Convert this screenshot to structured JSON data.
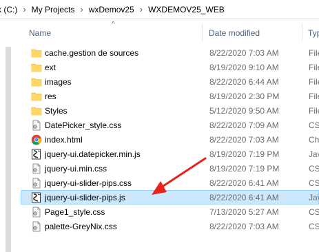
{
  "breadcrumb": [
    "k (C:)",
    "My Projects",
    "wxDemov25",
    "WXDEMOV25_WEB"
  ],
  "columns": {
    "name": "Name",
    "date": "Date modified",
    "type": "Typ"
  },
  "files": [
    {
      "name": "cache.gestion de sources",
      "date": "8/22/2020 7:03 AM",
      "type": "File",
      "icon": "folder-icon"
    },
    {
      "name": "ext",
      "date": "8/19/2020 9:10 AM",
      "type": "File",
      "icon": "folder-icon"
    },
    {
      "name": "images",
      "date": "8/22/2020 6:44 AM",
      "type": "File",
      "icon": "folder-icon"
    },
    {
      "name": "res",
      "date": "8/19/2020 2:30 PM",
      "type": "File",
      "icon": "folder-icon"
    },
    {
      "name": "Styles",
      "date": "5/12/2020 9:50 AM",
      "type": "File",
      "icon": "folder-icon"
    },
    {
      "name": "DatePicker_style.css",
      "date": "8/22/2020 7:09 AM",
      "type": "CSS",
      "icon": "css-file-icon"
    },
    {
      "name": "index.html",
      "date": "8/22/2020 7:03 AM",
      "type": "Chr",
      "icon": "chrome-icon"
    },
    {
      "name": "jquery-ui.datepicker.min.js",
      "date": "8/19/2020 7:19 PM",
      "type": "Jav",
      "icon": "js-file-icon"
    },
    {
      "name": "jquery-ui.min.css",
      "date": "8/19/2020 7:19 PM",
      "type": "CSS",
      "icon": "css-file-icon"
    },
    {
      "name": "jquery-ui-slider-pips.css",
      "date": "8/22/2020 6:41 AM",
      "type": "CSS",
      "icon": "css-file-icon"
    },
    {
      "name": "jquery-ui-slider-pips.js",
      "date": "8/22/2020 6:41 AM",
      "type": "Jav",
      "icon": "js-file-icon",
      "selected": true
    },
    {
      "name": "Page1_style.css",
      "date": "7/13/2020 5:27 AM",
      "type": "CSS",
      "icon": "css-file-icon"
    },
    {
      "name": "palette-GreyNix.css",
      "date": "8/22/2020 7:03 AM",
      "type": "CSS",
      "icon": "css-file-icon"
    }
  ],
  "colors": {
    "selection": "#cce8ff",
    "selection_border": "#99d1ff",
    "folder": "#ffd766",
    "arrow": "#e8231c",
    "header_text": "#4c607a"
  }
}
